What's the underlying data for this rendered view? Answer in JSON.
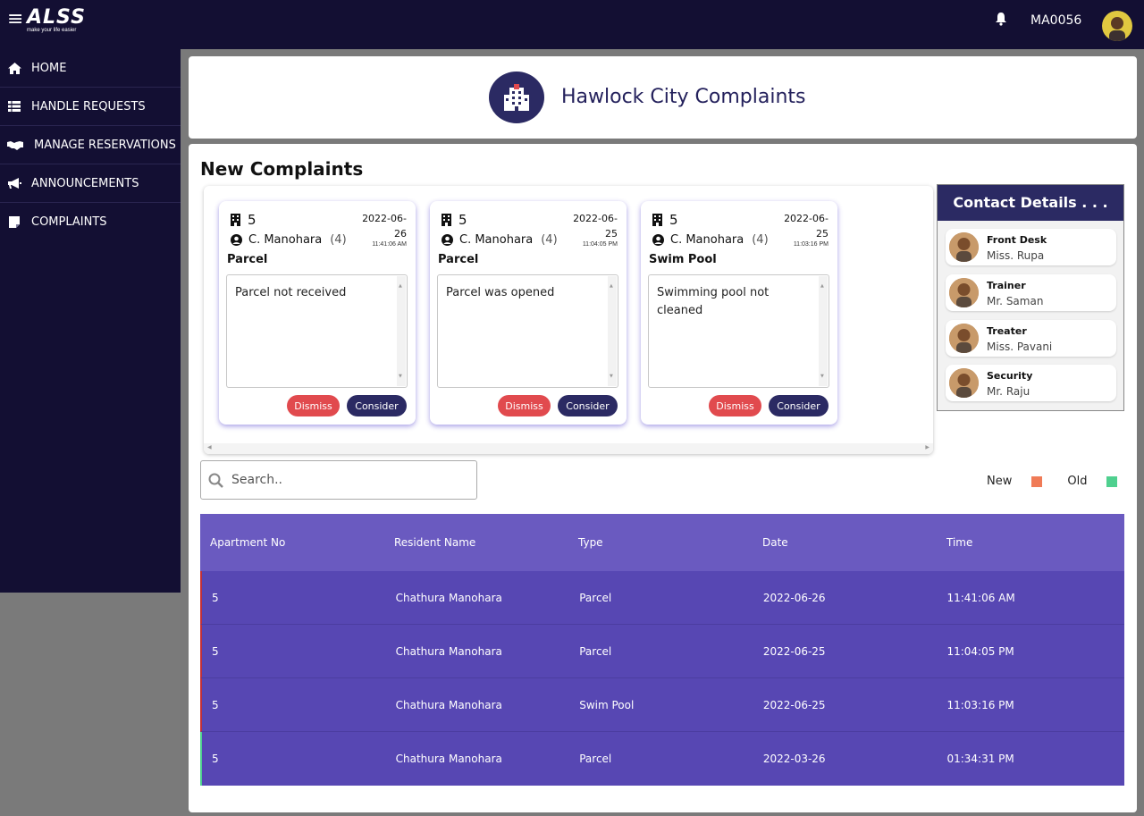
{
  "header": {
    "logo_text": "ALSS",
    "logo_tagline": "make your life easier",
    "user_id": "MA0056"
  },
  "sidebar": {
    "items": [
      {
        "label": "HOME",
        "icon": "home-icon"
      },
      {
        "label": "HANDLE REQUESTS",
        "icon": "list-icon"
      },
      {
        "label": "MANAGE RESERVATIONS",
        "icon": "handshake-icon"
      },
      {
        "label": "ANNOUNCEMENTS",
        "icon": "megaphone-icon"
      },
      {
        "label": "COMPLAINTS",
        "icon": "file-icon"
      }
    ]
  },
  "page": {
    "title": "Hawlock City Complaints",
    "section_title": "New Complaints"
  },
  "cards": [
    {
      "apartment": "5",
      "resident": "C. Manohara",
      "count": "(4)",
      "date_line1": "2022-06-",
      "date_line2": "26",
      "time": "11:41:06 AM",
      "type": "Parcel",
      "text": "Parcel not received",
      "dismiss": "Dismiss",
      "consider": "Consider"
    },
    {
      "apartment": "5",
      "resident": "C. Manohara",
      "count": "(4)",
      "date_line1": "2022-06-",
      "date_line2": "25",
      "time": "11:04:05 PM",
      "type": "Parcel",
      "text": "Parcel was opened",
      "dismiss": "Dismiss",
      "consider": "Consider"
    },
    {
      "apartment": "5",
      "resident": "C. Manohara",
      "count": "(4)",
      "date_line1": "2022-06-",
      "date_line2": "25",
      "time": "11:03:16 PM",
      "type": "Swim Pool",
      "text": "Swimming pool not cleaned",
      "dismiss": "Dismiss",
      "consider": "Consider"
    }
  ],
  "contacts": {
    "title": "Contact Details . . .",
    "items": [
      {
        "role": "Front Desk",
        "name": "Miss. Rupa"
      },
      {
        "role": "Trainer",
        "name": "Mr. Saman"
      },
      {
        "role": "Treater",
        "name": "Miss. Pavani"
      },
      {
        "role": "Security",
        "name": "Mr. Raju"
      }
    ]
  },
  "search": {
    "placeholder": "Search.."
  },
  "legend": {
    "new_label": "New",
    "old_label": "Old",
    "new_color": "#f07b57",
    "old_color": "#4fd08f"
  },
  "table": {
    "headers": [
      "Apartment No",
      "Resident Name",
      "Type",
      "Date",
      "Time"
    ],
    "rows": [
      {
        "apt": "5",
        "name": "Chathura Manohara",
        "type": "Parcel",
        "date": "2022-06-26",
        "time": "11:41:06 AM",
        "status": "new"
      },
      {
        "apt": "5",
        "name": "Chathura Manohara",
        "type": "Parcel",
        "date": "2022-06-25",
        "time": "11:04:05 PM",
        "status": "new"
      },
      {
        "apt": "5",
        "name": "Chathura Manohara",
        "type": "Swim Pool",
        "date": "2022-06-25",
        "time": "11:03:16 PM",
        "status": "new"
      },
      {
        "apt": "5",
        "name": "Chathura Manohara",
        "type": "Parcel",
        "date": "2022-03-26",
        "time": "01:34:31 PM",
        "status": "old"
      }
    ]
  },
  "colors": {
    "navy": "#130f33",
    "brand": "#2b2a63",
    "table_header": "#6a5ac0",
    "table_row": "#5747b3",
    "dismiss": "#e14a4e"
  }
}
